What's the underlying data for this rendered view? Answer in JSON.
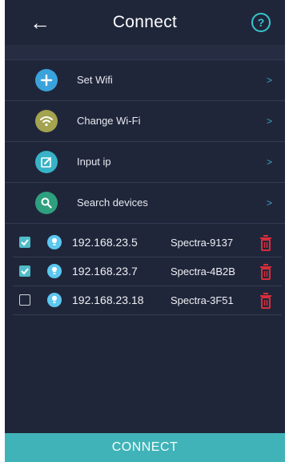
{
  "header": {
    "title": "Connect"
  },
  "menu": [
    {
      "label": "Set Wifi",
      "icon": "plus-icon",
      "color": "#3aa3dc"
    },
    {
      "label": "Change Wi-Fi",
      "icon": "wifi-icon",
      "color": "#a3a350"
    },
    {
      "label": "Input ip",
      "icon": "edit-icon",
      "color": "#38b2c6"
    },
    {
      "label": "Search devices",
      "icon": "search-icon",
      "color": "#2ea07e"
    }
  ],
  "devices": [
    {
      "ip": "192.168.23.5",
      "name": "Spectra-9137",
      "checked": true
    },
    {
      "ip": "192.168.23.7",
      "name": "Spectra-4B2B",
      "checked": true
    },
    {
      "ip": "192.168.23.18",
      "name": "Spectra-3F51",
      "checked": false
    }
  ],
  "footer": {
    "connect_label": "CONNECT"
  },
  "colors": {
    "background": "#20263a",
    "accent": "#40b3b8",
    "delete": "#d62e3a",
    "bulb": "#5cc8f0"
  }
}
